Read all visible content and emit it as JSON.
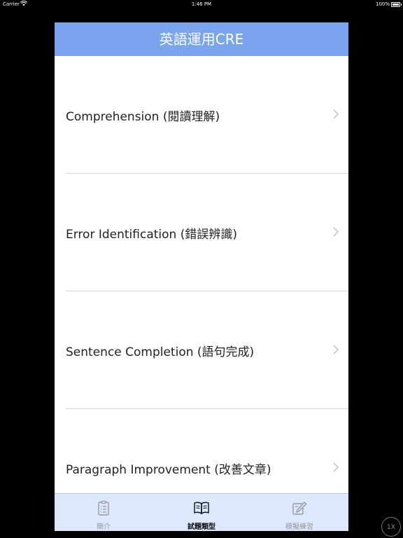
{
  "status_bar": {
    "carrier": "Carrier",
    "time": "1:46 PM",
    "battery": "100%"
  },
  "nav": {
    "title": "英語運用CRE"
  },
  "list": {
    "items": [
      {
        "label": "Comprehension (閱讀理解)"
      },
      {
        "label": "Error Identification (錯誤辨識)"
      },
      {
        "label": "Sentence Completion (語句完成)"
      },
      {
        "label": "Paragraph Improvement (改善文章)"
      }
    ]
  },
  "tabbar": {
    "tabs": [
      {
        "label": "簡介",
        "icon": "clipboard-icon",
        "active": false
      },
      {
        "label": "試題類型",
        "icon": "book-icon",
        "active": true
      },
      {
        "label": "模擬練習",
        "icon": "edit-icon",
        "active": false
      }
    ]
  },
  "zoom": {
    "label": "1X"
  },
  "colors": {
    "navbar": "#7aa5ee",
    "tabbar": "#dce8fb",
    "chevron": "#c7c7cc"
  }
}
